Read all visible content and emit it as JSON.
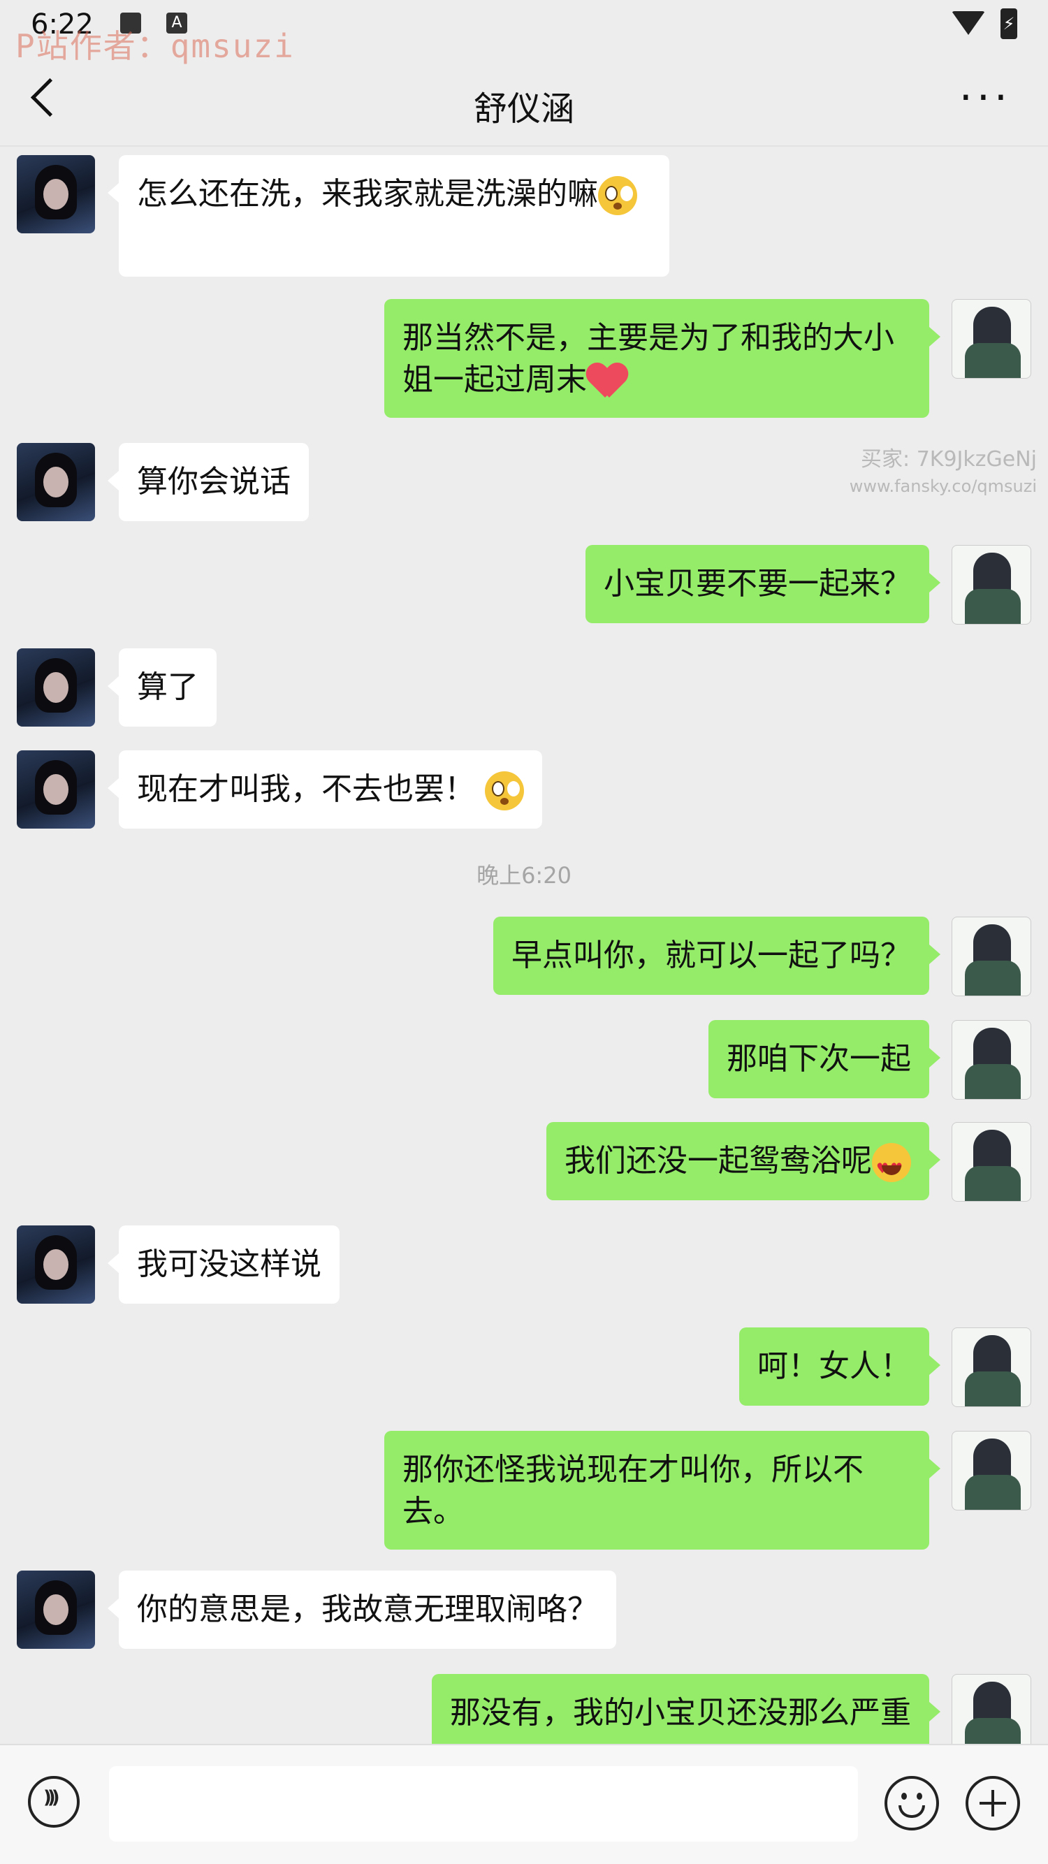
{
  "status_bar": {
    "time": "6:22",
    "icon_gallery": "gallery-icon",
    "icon_a": "A",
    "battery_glyph": "⚡"
  },
  "watermark_top": "P站作者：qmsuzi",
  "header": {
    "title": "舒仪涵",
    "back_icon": "chevron-left-icon",
    "more_label": "···"
  },
  "watermark_mid": {
    "line1": "买家: 7K9JkzGeNj",
    "line2": "www.fansky.co/qmsuzi"
  },
  "messages": [
    {
      "side": "left",
      "text": "怎么还在洗，来我家就是洗澡的嘛",
      "emoji": "flushed"
    },
    {
      "side": "right",
      "text": "那当然不是，主要是为了和我的大小姐一起过周末",
      "emoji": "heart"
    },
    {
      "side": "left",
      "text": "算你会说话"
    },
    {
      "side": "right",
      "text": "小宝贝要不要一起来？"
    },
    {
      "side": "left",
      "text": "算了"
    },
    {
      "side": "left",
      "text": "现在才叫我，不去也罢！",
      "emoji": "flushed"
    },
    {
      "side": "right",
      "text": "早点叫你，就可以一起了吗？"
    },
    {
      "side": "right",
      "text": "那咱下次一起"
    },
    {
      "side": "right",
      "text": "我们还没一起鸳鸯浴呢",
      "emoji": "heart-eyes"
    },
    {
      "side": "left",
      "text": "我可没这样说"
    },
    {
      "side": "right",
      "text": "呵！女人！"
    },
    {
      "side": "right",
      "text": "那你还怪我说现在才叫你，所以不去。"
    },
    {
      "side": "left",
      "text": "你的意思是，我故意无理取闹咯？"
    },
    {
      "side": "right",
      "text": "那没有，我的小宝贝还没那么严重"
    }
  ],
  "time_separator": "晚上6:20",
  "input_bar": {
    "voice_icon": "voice-icon",
    "emoji_icon": "emoji-icon",
    "plus_icon": "plus-icon",
    "text_value": ""
  }
}
